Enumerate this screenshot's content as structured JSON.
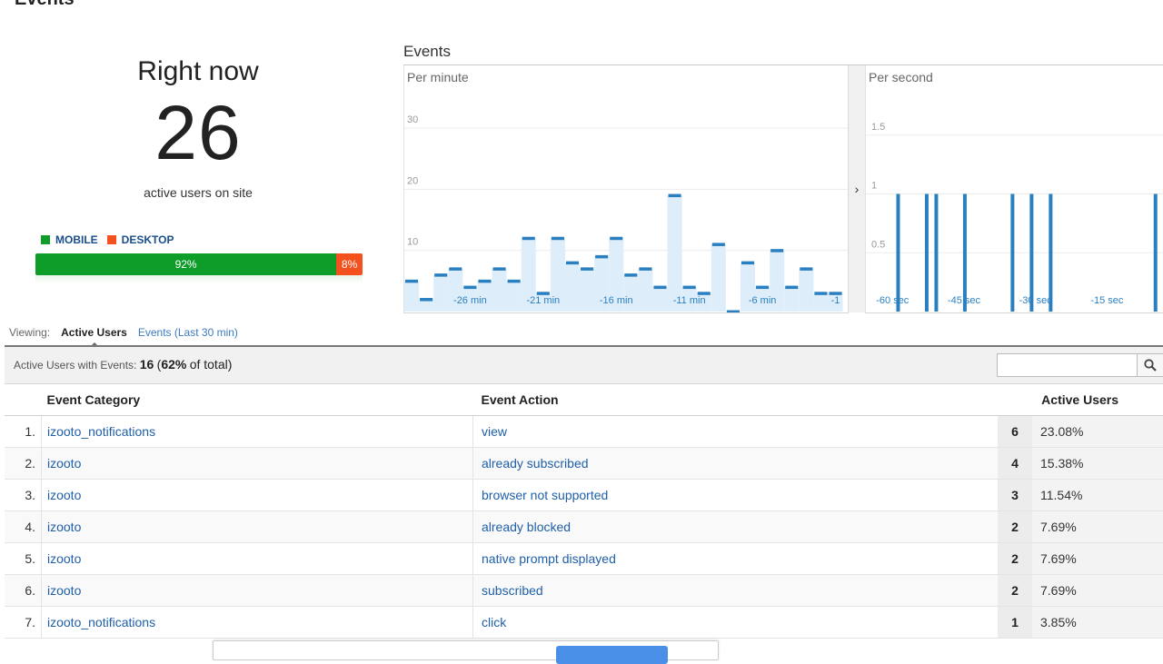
{
  "page": {
    "title": "Events"
  },
  "right_now": {
    "title": "Right now",
    "count": "26",
    "subtitle": "active users on site",
    "legend": [
      {
        "label": "MOBILE",
        "color": "#0f9d2a"
      },
      {
        "label": "DESKTOP",
        "color": "#f4511e"
      }
    ],
    "bar": [
      {
        "label": "92%",
        "value": 92,
        "color": "#0f9d2a"
      },
      {
        "label": "8%",
        "value": 8,
        "color": "#f4511e"
      }
    ]
  },
  "charts": {
    "title": "Events",
    "expand_icon": "chevron-right-icon",
    "expand_glyph": "›"
  },
  "chart_data": [
    {
      "type": "bar",
      "title": "Per minute",
      "ylim": [
        0,
        30
      ],
      "y_ticks": [
        {
          "value": 10,
          "label": "10"
        },
        {
          "value": 20,
          "label": "20"
        },
        {
          "value": 30,
          "label": "30"
        }
      ],
      "x_tick_labels": [
        {
          "at": 4,
          "label": "-26 min"
        },
        {
          "at": 9,
          "label": "-21 min"
        },
        {
          "at": 14,
          "label": "-16 min"
        },
        {
          "at": 19,
          "label": "-11 min"
        },
        {
          "at": 24,
          "label": "-6 min"
        },
        {
          "at": 29,
          "label": "-1"
        }
      ],
      "values": [
        5,
        2,
        6,
        7,
        4,
        5,
        7,
        5,
        12,
        3,
        12,
        8,
        7,
        9,
        12,
        6,
        7,
        4,
        19,
        4,
        3,
        11,
        0,
        8,
        4,
        10,
        4,
        7,
        3,
        3
      ],
      "color": "#2a7fc0"
    },
    {
      "type": "bar",
      "title": "Per second",
      "ylim": [
        0,
        2
      ],
      "y_ticks": [
        {
          "value": 0.5,
          "label": "0.5"
        },
        {
          "value": 1,
          "label": "1"
        },
        {
          "value": 1.5,
          "label": "1.5"
        }
      ],
      "x_tick_labels": [
        {
          "at": -60,
          "label": "-60 sec"
        },
        {
          "at": -45,
          "label": "-45 sec"
        },
        {
          "at": -30,
          "label": "-30 sec"
        },
        {
          "at": -15,
          "label": "-15 sec"
        }
      ],
      "x": [
        -55,
        -49,
        -47,
        -41,
        -31,
        -27,
        -23,
        -1
      ],
      "values": [
        1,
        1,
        1,
        1,
        1,
        1,
        1,
        1
      ],
      "xlim": [
        -61,
        0
      ],
      "color": "#2a7fc0"
    }
  ],
  "viewing": {
    "label": "Viewing:",
    "active_tab": "Active Users",
    "other_tab": "Events (Last 30 min)"
  },
  "summary": {
    "label": "Active Users with Events:",
    "count": "16",
    "paren_open": "(",
    "pct": "62%",
    "suffix": "of total)",
    "search_placeholder": "",
    "search_icon": "search-icon"
  },
  "table": {
    "headers": {
      "category": "Event Category",
      "action": "Event Action",
      "users": "Active Users"
    },
    "rows": [
      {
        "n": "1.",
        "category": "izooto_notifications",
        "action": "view",
        "users": "6",
        "pct": "23.08%"
      },
      {
        "n": "2.",
        "category": "izooto",
        "action": "already subscribed",
        "users": "4",
        "pct": "15.38%"
      },
      {
        "n": "3.",
        "category": "izooto",
        "action": "browser not supported",
        "users": "3",
        "pct": "11.54%"
      },
      {
        "n": "4.",
        "category": "izooto",
        "action": "already blocked",
        "users": "2",
        "pct": "7.69%"
      },
      {
        "n": "5.",
        "category": "izooto",
        "action": "native prompt displayed",
        "users": "2",
        "pct": "7.69%"
      },
      {
        "n": "6.",
        "category": "izooto",
        "action": "subscribed",
        "users": "2",
        "pct": "7.69%"
      },
      {
        "n": "7.",
        "category": "izooto_notifications",
        "action": "click",
        "users": "1",
        "pct": "3.85%"
      }
    ]
  }
}
